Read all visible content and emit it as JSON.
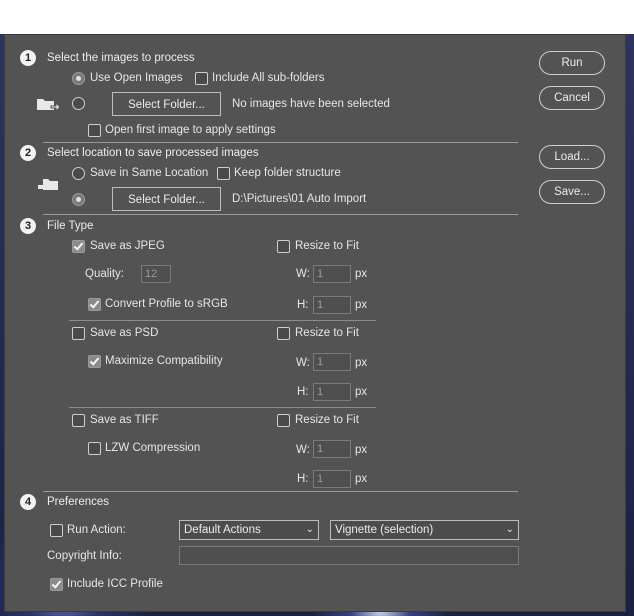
{
  "buttons": {
    "run": "Run",
    "cancel": "Cancel",
    "load": "Load...",
    "save": "Save..."
  },
  "section1": {
    "number": "1",
    "title": "Select the images to process",
    "use_open_images": "Use Open Images",
    "include_subfolders": "Include All sub-folders",
    "select_folder": "Select Folder...",
    "folder_status": "No images have been selected",
    "open_first_image": "Open first image to apply settings"
  },
  "section2": {
    "number": "2",
    "title": "Select location to save processed images",
    "save_same_location": "Save in Same Location",
    "keep_folder_structure": "Keep folder structure",
    "select_folder": "Select Folder...",
    "folder_path": "D:\\Pictures\\01 Auto Import"
  },
  "section3": {
    "number": "3",
    "title": "File Type",
    "jpeg": {
      "save_as": "Save as JPEG",
      "quality_label": "Quality:",
      "quality_value": "12",
      "convert_profile": "Convert Profile to sRGB",
      "resize": "Resize to Fit",
      "w_label": "W:",
      "w_value": "1",
      "h_label": "H:",
      "h_value": "1",
      "unit": "px"
    },
    "psd": {
      "save_as": "Save as PSD",
      "maximize": "Maximize Compatibility",
      "resize": "Resize to Fit",
      "w_label": "W:",
      "w_value": "1",
      "h_label": "H:",
      "h_value": "1",
      "unit": "px"
    },
    "tiff": {
      "save_as": "Save as TIFF",
      "lzw": "LZW Compression",
      "resize": "Resize to Fit",
      "w_label": "W:",
      "w_value": "1",
      "h_label": "H:",
      "h_value": "1",
      "unit": "px"
    }
  },
  "section4": {
    "number": "4",
    "title": "Preferences",
    "run_action": "Run Action:",
    "action_set": "Default Actions",
    "action": "Vignette (selection)",
    "copyright_label": "Copyright Info:",
    "copyright_value": "",
    "include_icc": "Include ICC Profile"
  },
  "icons": {
    "folder_in": "folder-import-icon",
    "folder_out": "folder-export-icon"
  },
  "colors": {
    "dialog_bg": "#535353",
    "text": "#e6e6e6"
  }
}
